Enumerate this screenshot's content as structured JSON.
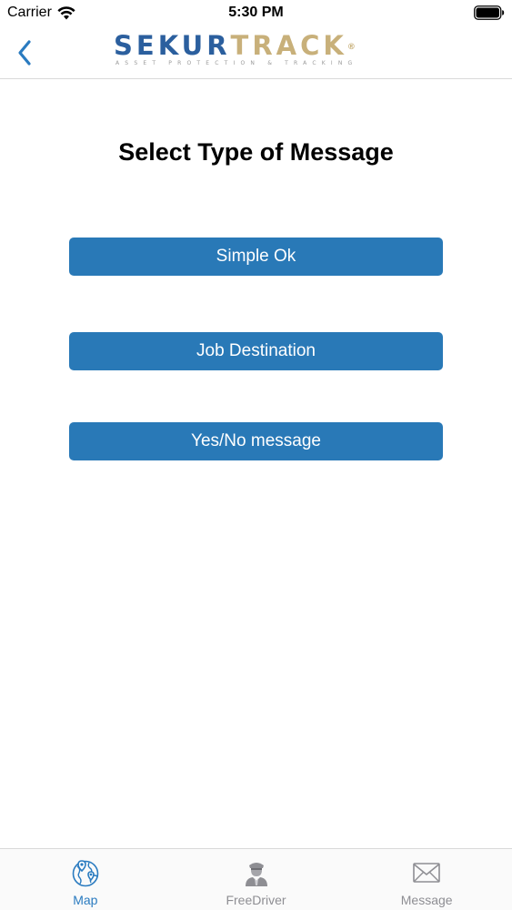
{
  "status_bar": {
    "carrier": "Carrier",
    "time": "5:30 PM"
  },
  "nav": {
    "back_icon": "chevron-left-icon",
    "logo": {
      "part1": "SEKUR",
      "part2": "TRACK",
      "registered": "®",
      "tagline": "ASSET PROTECTION & TRACKING"
    }
  },
  "main": {
    "title": "Select Type of Message",
    "buttons": [
      {
        "label": "Simple Ok"
      },
      {
        "label": "Job Destination"
      },
      {
        "label": "Yes/No message"
      }
    ]
  },
  "tab_bar": {
    "active_tab": "Map",
    "tabs": [
      {
        "label": "Map",
        "icon": "map-pin-globe-icon"
      },
      {
        "label": "FreeDriver",
        "icon": "driver-icon"
      },
      {
        "label": "Message",
        "icon": "envelope-icon"
      }
    ]
  },
  "colors": {
    "accent": "#2a7bc0",
    "button_bg": "#2979b7",
    "logo_blue": "#2b5f9e",
    "logo_gold": "#c8b07a",
    "inactive_tab": "#8e8e93"
  }
}
